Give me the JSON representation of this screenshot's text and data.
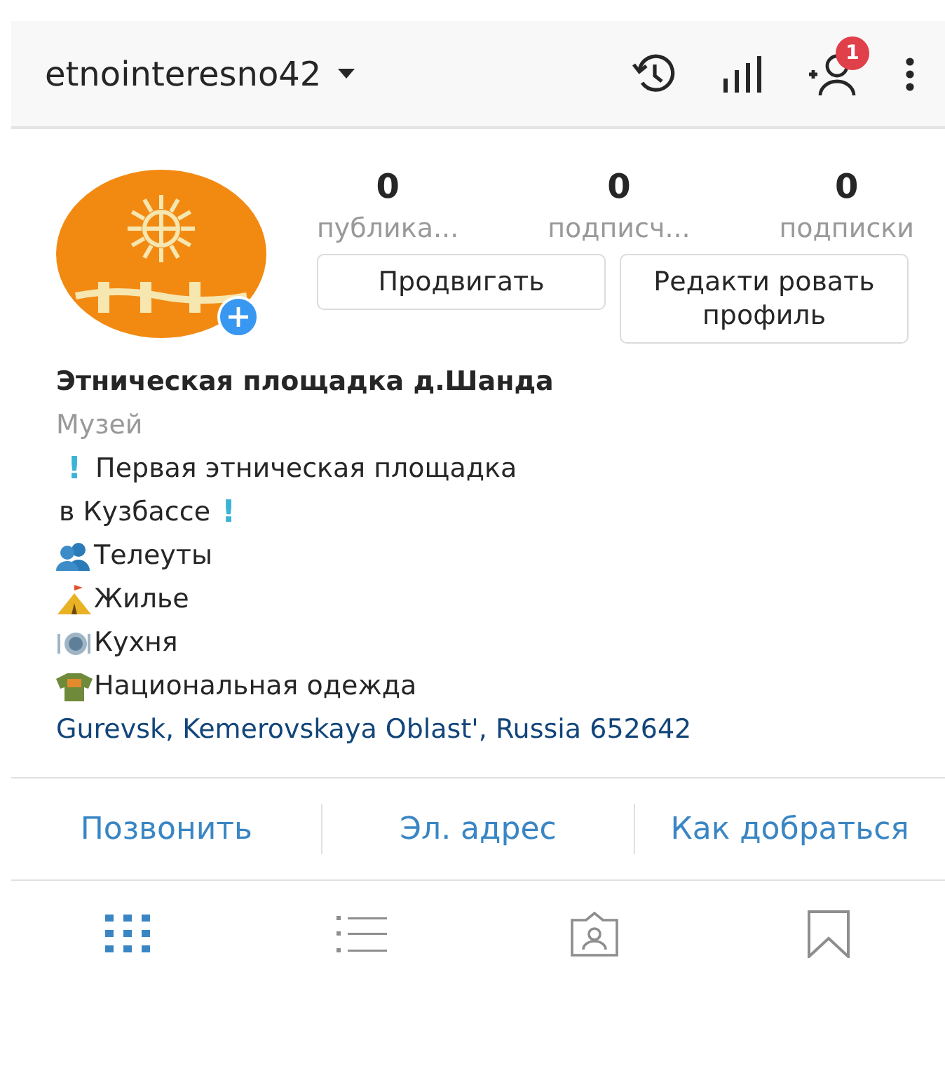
{
  "top_bar": {
    "username": "etnointeresno42",
    "notification_badge": "1"
  },
  "profile": {
    "avatar": {
      "kind": "picture"
    },
    "stats": [
      {
        "count": "0",
        "label": "публика..."
      },
      {
        "count": "0",
        "label": "подписч..."
      },
      {
        "count": "0",
        "label": "подписки"
      }
    ],
    "buttons": [
      "Продвигать",
      "Редакти ровать профиль"
    ]
  },
  "bio": {
    "name": "Этническая площадка д.Шанда",
    "category": "Музей",
    "lines": [
      {
        "kind": "mark-before",
        "mark": "!",
        "text": "Первая этническая площадка"
      },
      {
        "kind": "mark-after",
        "mark": "!",
        "text": "в Кузбассе"
      },
      {
        "kind": "emoji",
        "text": "Телеуты"
      },
      {
        "kind": "emoji",
        "text": "Жилье"
      },
      {
        "kind": "emoji",
        "text": "Кухня"
      },
      {
        "kind": "emoji",
        "text": "Национальная одежда"
      }
    ],
    "address": "Gurevsk, Kemerovskaya Oblast', Russia 652642"
  },
  "actions": [
    "Позвонить",
    "Эл. адрес",
    "Как добраться"
  ],
  "tabs": [
    {
      "selected": true
    },
    {
      "selected": false
    },
    {
      "selected": false
    },
    {
      "selected": false
    }
  ]
}
